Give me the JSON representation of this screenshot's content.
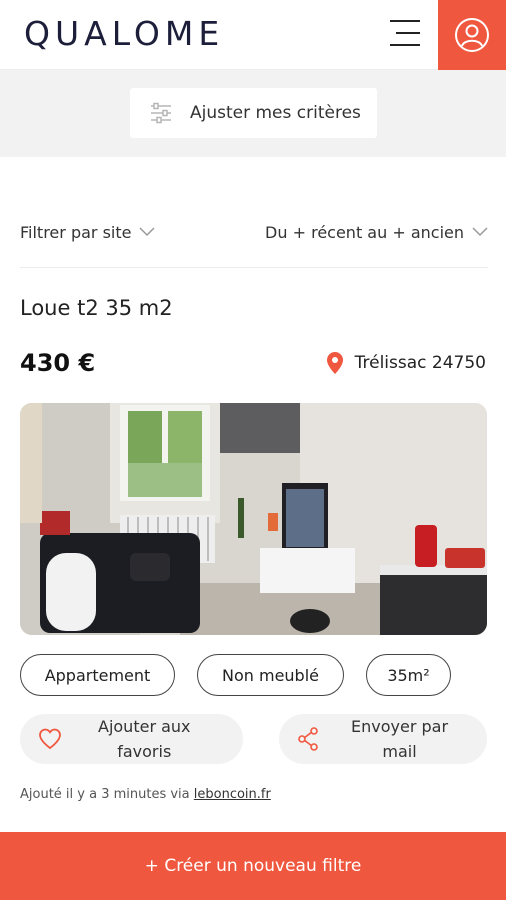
{
  "header": {
    "logo_text": "QUALOME",
    "menu_icon": "hamburger-icon",
    "user_icon": "user-icon"
  },
  "criteria": {
    "label": "Ajuster mes critères",
    "icon": "sliders-icon"
  },
  "filters": {
    "site_filter_label": "Filtrer par site",
    "sort_label": "Du + récent au + ancien"
  },
  "listing": {
    "title": "Loue t2 35 m2",
    "price": "430 €",
    "location": "Trélissac 24750",
    "tags": [
      "Appartement",
      "Non meublé",
      "35m²"
    ],
    "favorite_label_line1": "Ajouter aux",
    "favorite_label_line2": "favoris",
    "share_label_line1": "Envoyer par",
    "share_label_line2": "mail",
    "added_prefix": "Ajouté il y a 3 minutes via ",
    "source_site": "leboncoin.fr"
  },
  "cta": {
    "label": "+ Créer un nouveau filtre"
  },
  "colors": {
    "accent": "#f0573f",
    "logo": "#1d1f3a"
  }
}
